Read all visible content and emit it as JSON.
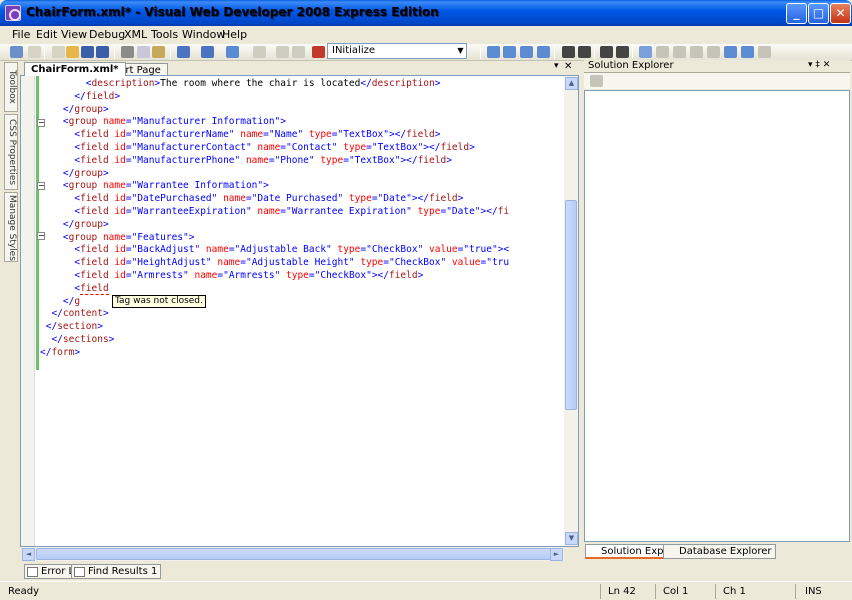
{
  "window": {
    "title": "ChairForm.xml* - Visual Web Developer 2008 Express Edition",
    "min_glyph": "_",
    "max_glyph": "□",
    "close_glyph": "✕"
  },
  "menu": [
    "File",
    "Edit",
    "View",
    "Debug",
    "XML",
    "Tools",
    "Window",
    "Help"
  ],
  "toolbar": {
    "combo_value": "INitialize"
  },
  "left_tabs": [
    "Toolbox",
    "CSS Properties",
    "Manage Styles"
  ],
  "doc_tabs": {
    "active": "ChairForm.xml*",
    "other": "Start Page",
    "close_glyph": "✕",
    "dropdown_glyph": "▾"
  },
  "editor": {
    "lines": [
      [
        {
          "t": "        "
        },
        {
          "c": "val",
          "t": "<"
        },
        {
          "c": "tag",
          "t": "description"
        },
        {
          "c": "val",
          "t": ">"
        },
        {
          "c": "txt",
          "t": "The room where the chair is located"
        },
        {
          "c": "val",
          "t": "</"
        },
        {
          "c": "tag",
          "t": "description"
        },
        {
          "c": "val",
          "t": ">"
        }
      ],
      [
        {
          "t": "      "
        },
        {
          "c": "val",
          "t": "</"
        },
        {
          "c": "tag",
          "t": "field"
        },
        {
          "c": "val",
          "t": ">"
        }
      ],
      [
        {
          "t": "    "
        },
        {
          "c": "val",
          "t": "</"
        },
        {
          "c": "tag",
          "t": "group"
        },
        {
          "c": "val",
          "t": ">"
        }
      ],
      [
        {
          "t": "    "
        },
        {
          "c": "val",
          "t": "<"
        },
        {
          "c": "tag",
          "t": "group"
        },
        {
          "c": "att",
          "t": " name"
        },
        {
          "c": "val",
          "t": "=\"Manufacturer Information\">"
        }
      ],
      [
        {
          "t": "      "
        },
        {
          "c": "val",
          "t": "<"
        },
        {
          "c": "tag",
          "t": "field"
        },
        {
          "c": "att",
          "t": " id"
        },
        {
          "c": "val",
          "t": "=\"ManufacturerName\""
        },
        {
          "c": "att",
          "t": " name"
        },
        {
          "c": "val",
          "t": "=\"Name\""
        },
        {
          "c": "att",
          "t": " type"
        },
        {
          "c": "val",
          "t": "=\"TextBox\"></"
        },
        {
          "c": "tag",
          "t": "field"
        },
        {
          "c": "val",
          "t": ">"
        }
      ],
      [
        {
          "t": "      "
        },
        {
          "c": "val",
          "t": "<"
        },
        {
          "c": "tag",
          "t": "field"
        },
        {
          "c": "att",
          "t": " id"
        },
        {
          "c": "val",
          "t": "=\"ManufacturerContact\""
        },
        {
          "c": "att",
          "t": " name"
        },
        {
          "c": "val",
          "t": "=\"Contact\""
        },
        {
          "c": "att",
          "t": " type"
        },
        {
          "c": "val",
          "t": "=\"TextBox\"></"
        },
        {
          "c": "tag",
          "t": "field"
        },
        {
          "c": "val",
          "t": ">"
        }
      ],
      [
        {
          "t": "      "
        },
        {
          "c": "val",
          "t": "<"
        },
        {
          "c": "tag",
          "t": "field"
        },
        {
          "c": "att",
          "t": " id"
        },
        {
          "c": "val",
          "t": "=\"ManufacturerPhone\""
        },
        {
          "c": "att",
          "t": " name"
        },
        {
          "c": "val",
          "t": "=\"Phone\""
        },
        {
          "c": "att",
          "t": " type"
        },
        {
          "c": "val",
          "t": "=\"TextBox\"></"
        },
        {
          "c": "tag",
          "t": "field"
        },
        {
          "c": "val",
          "t": ">"
        }
      ],
      [
        {
          "t": "    "
        },
        {
          "c": "val",
          "t": "</"
        },
        {
          "c": "tag",
          "t": "group"
        },
        {
          "c": "val",
          "t": ">"
        }
      ],
      [
        {
          "t": "    "
        },
        {
          "c": "val",
          "t": "<"
        },
        {
          "c": "tag",
          "t": "group"
        },
        {
          "c": "att",
          "t": " name"
        },
        {
          "c": "val",
          "t": "=\"Warrantee Information\">"
        }
      ],
      [
        {
          "t": "      "
        },
        {
          "c": "val",
          "t": "<"
        },
        {
          "c": "tag",
          "t": "field"
        },
        {
          "c": "att",
          "t": " id"
        },
        {
          "c": "val",
          "t": "=\"DatePurchased\""
        },
        {
          "c": "att",
          "t": " name"
        },
        {
          "c": "val",
          "t": "=\"Date Purchased\""
        },
        {
          "c": "att",
          "t": " type"
        },
        {
          "c": "val",
          "t": "=\"Date\"></"
        },
        {
          "c": "tag",
          "t": "field"
        },
        {
          "c": "val",
          "t": ">"
        }
      ],
      [
        {
          "t": "      "
        },
        {
          "c": "val",
          "t": "<"
        },
        {
          "c": "tag",
          "t": "field"
        },
        {
          "c": "att",
          "t": " id"
        },
        {
          "c": "val",
          "t": "=\"WarranteeExpiration\""
        },
        {
          "c": "att",
          "t": " name"
        },
        {
          "c": "val",
          "t": "=\"Warrantee Expiration\""
        },
        {
          "c": "att",
          "t": " type"
        },
        {
          "c": "val",
          "t": "=\"Date\"></"
        },
        {
          "c": "tag",
          "t": "fi"
        }
      ],
      [
        {
          "t": "    "
        },
        {
          "c": "val",
          "t": "</"
        },
        {
          "c": "tag",
          "t": "group"
        },
        {
          "c": "val",
          "t": ">"
        }
      ],
      [
        {
          "t": "    "
        },
        {
          "c": "val",
          "t": "<"
        },
        {
          "c": "tag",
          "t": "group"
        },
        {
          "c": "att",
          "t": " name"
        },
        {
          "c": "val",
          "t": "=\"Features\">"
        }
      ],
      [
        {
          "t": "      "
        },
        {
          "c": "val",
          "t": "<"
        },
        {
          "c": "tag",
          "t": "field"
        },
        {
          "c": "att",
          "t": " id"
        },
        {
          "c": "val",
          "t": "=\"BackAdjust\""
        },
        {
          "c": "att",
          "t": " name"
        },
        {
          "c": "val",
          "t": "=\"Adjustable Back\""
        },
        {
          "c": "att",
          "t": " type"
        },
        {
          "c": "val",
          "t": "=\"CheckBox\""
        },
        {
          "c": "att",
          "t": " value"
        },
        {
          "c": "val",
          "t": "=\"true\"><"
        }
      ],
      [
        {
          "t": "      "
        },
        {
          "c": "val",
          "t": "<"
        },
        {
          "c": "tag",
          "t": "field"
        },
        {
          "c": "att",
          "t": " id"
        },
        {
          "c": "val",
          "t": "=\"HeightAdjust\""
        },
        {
          "c": "att",
          "t": " name"
        },
        {
          "c": "val",
          "t": "=\"Adjustable Height\""
        },
        {
          "c": "att",
          "t": " type"
        },
        {
          "c": "val",
          "t": "=\"CheckBox\""
        },
        {
          "c": "att",
          "t": " value"
        },
        {
          "c": "val",
          "t": "=\"tru"
        }
      ],
      [
        {
          "t": "      "
        },
        {
          "c": "val",
          "t": "<"
        },
        {
          "c": "tag",
          "t": "field"
        },
        {
          "c": "att",
          "t": " id"
        },
        {
          "c": "val",
          "t": "=\"Armrests\""
        },
        {
          "c": "att",
          "t": " name"
        },
        {
          "c": "val",
          "t": "=\"Armrests\""
        },
        {
          "c": "att",
          "t": " type"
        },
        {
          "c": "val",
          "t": "=\"CheckBox\"></"
        },
        {
          "c": "tag",
          "t": "field"
        },
        {
          "c": "val",
          "t": ">"
        }
      ],
      [
        {
          "t": "      "
        },
        {
          "c": "val",
          "t": "<"
        },
        {
          "c": "err",
          "t": "field"
        }
      ],
      [
        {
          "t": "    "
        },
        {
          "c": "val",
          "t": "</"
        },
        {
          "c": "tag",
          "t": "g"
        }
      ],
      [
        {
          "t": "  "
        },
        {
          "c": "val",
          "t": "</"
        },
        {
          "c": "tag",
          "t": "content"
        },
        {
          "c": "val",
          "t": ">"
        }
      ],
      [
        {
          "t": " "
        },
        {
          "c": "val",
          "t": "</"
        },
        {
          "c": "tag",
          "t": "section"
        },
        {
          "c": "val",
          "t": ">"
        }
      ],
      [
        {
          "t": "  "
        },
        {
          "c": "val",
          "t": "</"
        },
        {
          "c": "tag",
          "t": "sections"
        },
        {
          "c": "val",
          "t": ">"
        }
      ],
      [
        {
          "c": "val",
          "t": "</"
        },
        {
          "c": "tag",
          "t": "form"
        },
        {
          "c": "val",
          "t": ">"
        }
      ]
    ],
    "tooltip": "Tag was not closed.",
    "scroll_up": "▲",
    "scroll_down": "▼",
    "scroll_left": "◄",
    "scroll_right": "►"
  },
  "bottom_tabs": [
    "Error List",
    "Find Results 1"
  ],
  "solution_explorer": {
    "title": "Solution Explorer",
    "buttons": "▾ ‡ ✕",
    "tabs": [
      "Solution Explorer",
      "Database Explorer"
    ]
  },
  "status": {
    "text": "Ready",
    "ln": "Ln 42",
    "col": "Col 1",
    "ch": "Ch 1",
    "mode": "INS"
  },
  "colors": {
    "title_bar": "#0058e6",
    "tag": "#a31515",
    "attribute": "#ff0000",
    "value": "#0000ff",
    "change_bar": "#6ac26a"
  }
}
